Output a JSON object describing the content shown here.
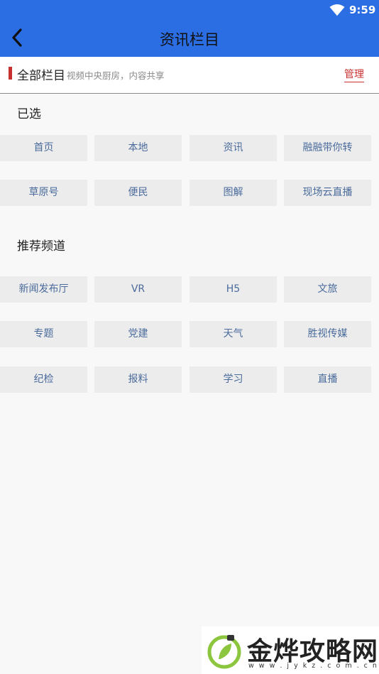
{
  "status_bar": {
    "time": "9:59"
  },
  "app_bar": {
    "title": "资讯栏目"
  },
  "all_columns": {
    "label": "全部栏目",
    "hint": "视频中央厨房，内容共享",
    "manage_label": "管理"
  },
  "selected": {
    "title": "已选",
    "items": [
      "首页",
      "本地",
      "资讯",
      "融融带你转",
      "草原号",
      "便民",
      "图解",
      "现场云直播"
    ]
  },
  "recommended": {
    "title": "推荐频道",
    "items": [
      "新闻发布厅",
      "VR",
      "H5",
      "文旅",
      "专题",
      "党建",
      "天气",
      "胜视传媒",
      "纪检",
      "报料",
      "学习",
      "直播"
    ]
  },
  "watermark": {
    "text": "金烨攻略网",
    "url": "w w w . j y k z . c o m . c n"
  },
  "colors": {
    "primary": "#2b6de3",
    "accent": "#c8312f",
    "chip_bg": "#ececec",
    "chip_text": "#4a6b9c"
  }
}
